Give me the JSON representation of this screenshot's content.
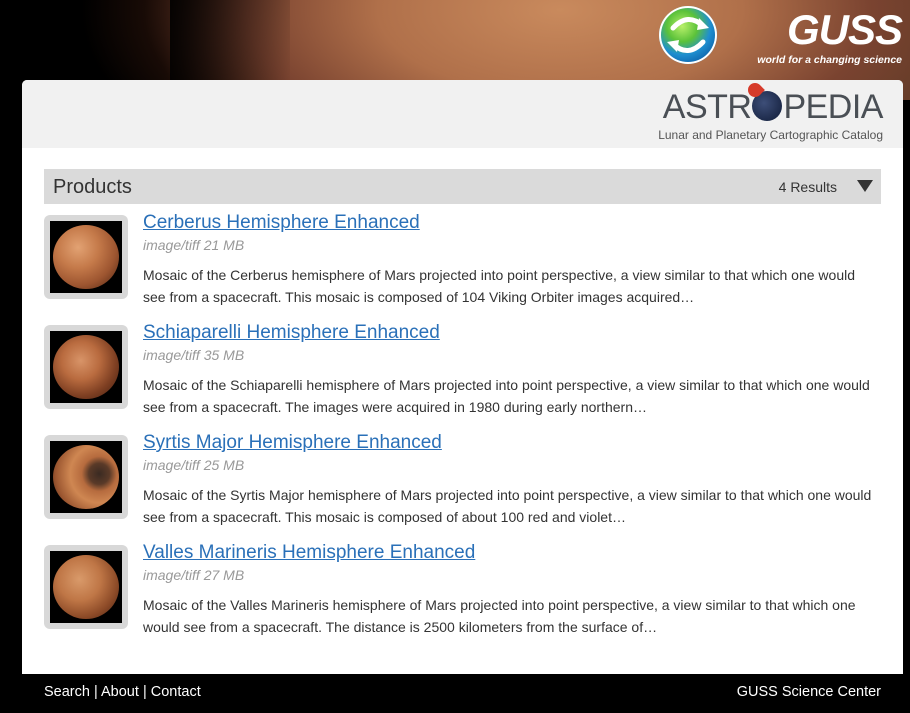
{
  "brand": {
    "guss_name": "GUSS",
    "guss_tagline": "world for a changing science",
    "astro_pre": "ASTR",
    "astro_post": "PEDIA",
    "astro_subtitle": "Lunar and Planetary Cartographic Catalog"
  },
  "products": {
    "title": "Products",
    "results_text": "4 Results"
  },
  "items": [
    {
      "title": "Cerberus Hemisphere Enhanced",
      "meta": "image/tiff 21 MB",
      "description": "Mosaic of the Cerberus hemisphere of Mars projected into point perspective, a view similar to that which one would see from a spacecraft. This mosaic is composed of 104 Viking Orbiter images acquired…"
    },
    {
      "title": "Schiaparelli Hemisphere Enhanced",
      "meta": "image/tiff 35 MB",
      "description": "Mosaic of the Schiaparelli hemisphere of Mars projected into point perspective, a view similar to that which one would see from a spacecraft. The images were acquired in 1980 during early northern…"
    },
    {
      "title": "Syrtis Major Hemisphere Enhanced",
      "meta": "image/tiff 25 MB",
      "description": "Mosaic of the Syrtis Major hemisphere of Mars projected into point perspective, a view similar to that which one would see from a spacecraft. This mosaic is composed of about 100 red and violet…"
    },
    {
      "title": "Valles Marineris Hemisphere Enhanced",
      "meta": "image/tiff 27 MB",
      "description": "Mosaic of the Valles Marineris hemisphere of Mars projected into point perspective, a view similar to that which one would see from a spacecraft. The distance is 2500 kilometers from the surface of…"
    }
  ],
  "footer": {
    "search": "Search",
    "about": "About",
    "contact": "Contact",
    "separator": "|",
    "right_text": "GUSS Science Center"
  },
  "colors": {
    "link": "#2a70b8",
    "bar": "#dadada",
    "footer_bg": "#000000"
  }
}
